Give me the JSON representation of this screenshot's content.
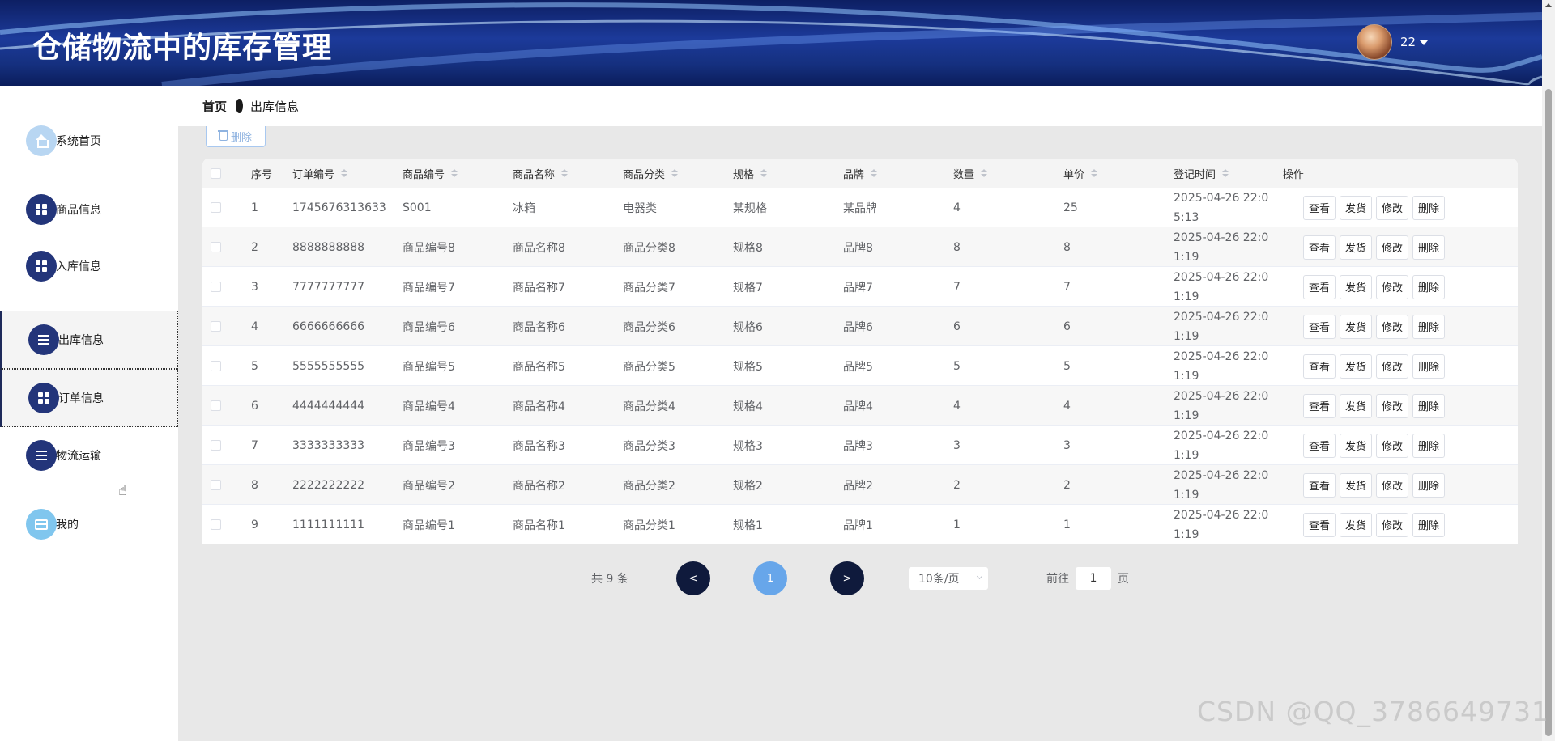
{
  "header": {
    "title": "仓储物流中的库存管理",
    "user": "22"
  },
  "breadcrumb": {
    "home": "首页",
    "current": "出库信息"
  },
  "sidebar": {
    "items": [
      {
        "label": "系统首页",
        "icon": "home-icon"
      },
      {
        "label": "商品信息",
        "icon": "grid-icon"
      },
      {
        "label": "入库信息",
        "icon": "grid-icon"
      },
      {
        "label": "出库信息",
        "icon": "list-icon"
      },
      {
        "label": "订单信息",
        "icon": "grid-icon"
      },
      {
        "label": "物流运输",
        "icon": "list-icon"
      },
      {
        "label": "我的",
        "icon": "card-icon"
      }
    ]
  },
  "toolbar": {
    "delete_label": "删除"
  },
  "table": {
    "columns": [
      "序号",
      "订单编号",
      "商品编号",
      "商品名称",
      "商品分类",
      "规格",
      "品牌",
      "数量",
      "单价",
      "登记时间",
      "操作"
    ],
    "actions": [
      "查看",
      "发货",
      "修改",
      "删除"
    ],
    "rows": [
      {
        "idx": "1",
        "order": "1745676313633",
        "code": "S001",
        "name": "冰箱",
        "category": "电器类",
        "spec": "某规格",
        "brand": "某品牌",
        "qty": "4",
        "price": "25",
        "time": "2025-04-26 22:05:13"
      },
      {
        "idx": "2",
        "order": "8888888888",
        "code": "商品编号8",
        "name": "商品名称8",
        "category": "商品分类8",
        "spec": "规格8",
        "brand": "品牌8",
        "qty": "8",
        "price": "8",
        "time": "2025-04-26 22:01:19"
      },
      {
        "idx": "3",
        "order": "7777777777",
        "code": "商品编号7",
        "name": "商品名称7",
        "category": "商品分类7",
        "spec": "规格7",
        "brand": "品牌7",
        "qty": "7",
        "price": "7",
        "time": "2025-04-26 22:01:19"
      },
      {
        "idx": "4",
        "order": "6666666666",
        "code": "商品编号6",
        "name": "商品名称6",
        "category": "商品分类6",
        "spec": "规格6",
        "brand": "品牌6",
        "qty": "6",
        "price": "6",
        "time": "2025-04-26 22:01:19"
      },
      {
        "idx": "5",
        "order": "5555555555",
        "code": "商品编号5",
        "name": "商品名称5",
        "category": "商品分类5",
        "spec": "规格5",
        "brand": "品牌5",
        "qty": "5",
        "price": "5",
        "time": "2025-04-26 22:01:19"
      },
      {
        "idx": "6",
        "order": "4444444444",
        "code": "商品编号4",
        "name": "商品名称4",
        "category": "商品分类4",
        "spec": "规格4",
        "brand": "品牌4",
        "qty": "4",
        "price": "4",
        "time": "2025-04-26 22:01:19"
      },
      {
        "idx": "7",
        "order": "3333333333",
        "code": "商品编号3",
        "name": "商品名称3",
        "category": "商品分类3",
        "spec": "规格3",
        "brand": "品牌3",
        "qty": "3",
        "price": "3",
        "time": "2025-04-26 22:01:19"
      },
      {
        "idx": "8",
        "order": "2222222222",
        "code": "商品编号2",
        "name": "商品名称2",
        "category": "商品分类2",
        "spec": "规格2",
        "brand": "品牌2",
        "qty": "2",
        "price": "2",
        "time": "2025-04-26 22:01:19"
      },
      {
        "idx": "9",
        "order": "1111111111",
        "code": "商品编号1",
        "name": "商品名称1",
        "category": "商品分类1",
        "spec": "规格1",
        "brand": "品牌1",
        "qty": "1",
        "price": "1",
        "time": "2025-04-26 22:01:19"
      }
    ]
  },
  "pagination": {
    "total": "共 9 条",
    "prev": "<",
    "next": ">",
    "current": "1",
    "page_size": "10条/页",
    "goto_prefix": "前往",
    "goto_value": "1",
    "goto_suffix": "页"
  },
  "watermark": "CSDN @QQ_3786649731"
}
